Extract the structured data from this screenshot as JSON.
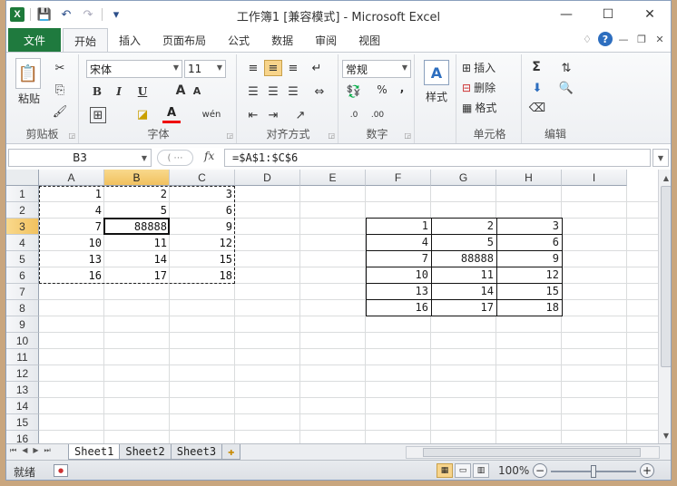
{
  "window": {
    "title": "工作簿1  [兼容模式]  -  Microsoft Excel",
    "app_icon": "X",
    "qat": {
      "save": "💾",
      "undo": "↶",
      "redo": "↷",
      "customize": "▾"
    },
    "controls": {
      "minimize": "—",
      "maximize": "☐",
      "close": "✕"
    }
  },
  "tabs": {
    "file": "文件",
    "items": [
      "开始",
      "插入",
      "页面布局",
      "公式",
      "数据",
      "审阅",
      "视图"
    ],
    "active": "开始",
    "right": {
      "collapse": "♢",
      "help": "?",
      "min": "—",
      "restore": "❐",
      "close": "✕"
    }
  },
  "ribbon": {
    "clipboard": {
      "label": "剪贴板",
      "paste": "粘贴"
    },
    "font": {
      "label": "字体",
      "name": "宋体",
      "size": "11",
      "bold": "B",
      "italic": "I",
      "underline": "U",
      "grow": "A",
      "shrink": "A",
      "phonetic": "wén",
      "font_color": "A",
      "fill_color": "◪"
    },
    "align": {
      "label": "对齐方式"
    },
    "number": {
      "label": "数字",
      "format": "常规",
      "percent": "%",
      "comma": ",",
      "inc": ".0←.00",
      "dec": ".00→.0"
    },
    "styles": {
      "label": "样式"
    },
    "cells": {
      "label": "单元格",
      "insert": "插入",
      "delete": "删除",
      "format": "格式"
    },
    "editing": {
      "label": "编辑",
      "sum": "Σ"
    }
  },
  "formula_bar": {
    "name_box": "B3",
    "fx": "fx",
    "formula": "=$A$1:$C$6",
    "dots": "( ⋯"
  },
  "grid": {
    "columns": [
      "A",
      "B",
      "C",
      "D",
      "E",
      "F",
      "G",
      "H",
      "I"
    ],
    "rows": [
      "1",
      "2",
      "3",
      "4",
      "5",
      "6",
      "7",
      "8",
      "9",
      "10",
      "11",
      "12",
      "13",
      "14",
      "15",
      "16"
    ],
    "selected_column": "B",
    "selected_row": "3",
    "left_block": [
      [
        "1",
        "2",
        "3"
      ],
      [
        "4",
        "5",
        "6"
      ],
      [
        "7",
        "88888",
        "9"
      ],
      [
        "10",
        "11",
        "12"
      ],
      [
        "13",
        "14",
        "15"
      ],
      [
        "16",
        "17",
        "18"
      ]
    ],
    "right_block": [
      [
        "1",
        "2",
        "3"
      ],
      [
        "4",
        "5",
        "6"
      ],
      [
        "7",
        "88888",
        "9"
      ],
      [
        "10",
        "11",
        "12"
      ],
      [
        "13",
        "14",
        "15"
      ],
      [
        "16",
        "17",
        "18"
      ]
    ]
  },
  "sheets": {
    "tabs": [
      "Sheet1",
      "Sheet2",
      "Sheet3"
    ],
    "active": "Sheet1",
    "new_sheet": "✚",
    "nav": [
      "⏮",
      "◀",
      "▶",
      "⏭"
    ]
  },
  "status": {
    "ready": "就绪",
    "zoom": "100%",
    "zoom_minus": "−",
    "zoom_plus": "+"
  }
}
